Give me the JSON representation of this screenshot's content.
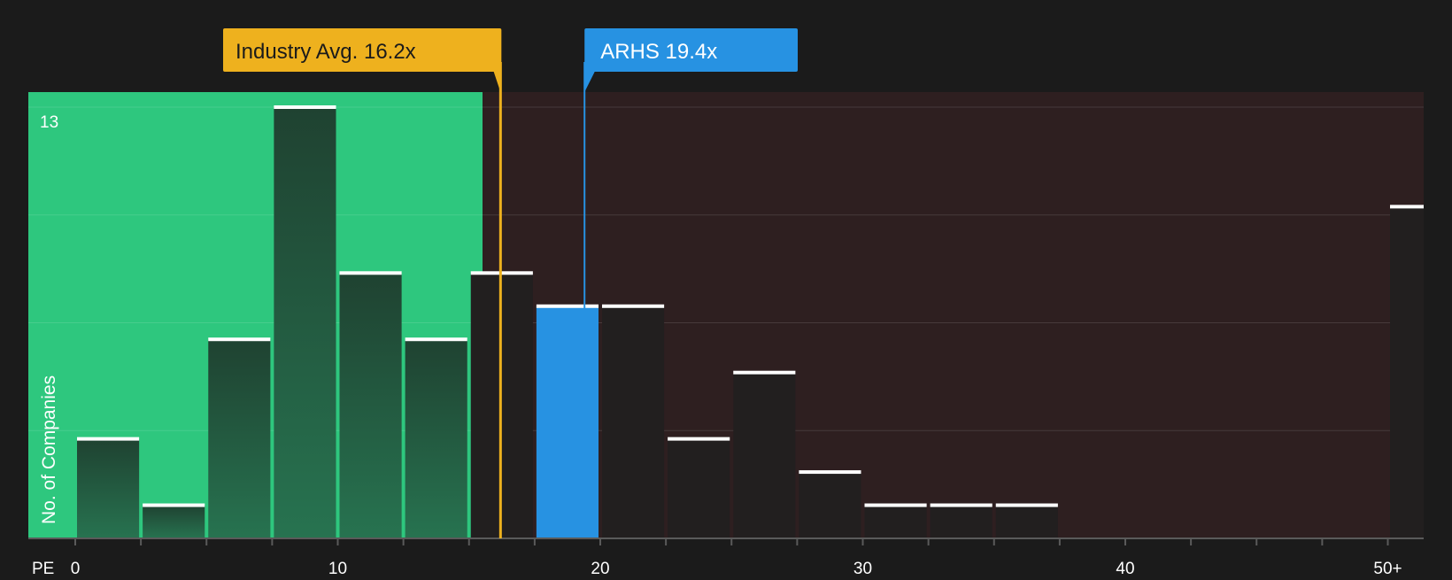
{
  "chart_data": {
    "type": "bar",
    "title": "",
    "xlabel": "PE",
    "ylabel": "No. of Companies",
    "ymax_label": "13",
    "ylim": [
      0,
      13
    ],
    "x_ticks": [
      "0",
      "10",
      "20",
      "30",
      "40",
      "50+"
    ],
    "bins": [
      {
        "range": "0-2.5",
        "value": 3
      },
      {
        "range": "2.5-5",
        "value": 1
      },
      {
        "range": "5-7.5",
        "value": 6
      },
      {
        "range": "7.5-10",
        "value": 13
      },
      {
        "range": "10-12.5",
        "value": 8
      },
      {
        "range": "12.5-15",
        "value": 6
      },
      {
        "range": "15-17.5",
        "value": 8
      },
      {
        "range": "17.5-20",
        "value": 7,
        "highlight": true
      },
      {
        "range": "20-22.5",
        "value": 7
      },
      {
        "range": "22.5-25",
        "value": 3
      },
      {
        "range": "25-27.5",
        "value": 5
      },
      {
        "range": "27.5-30",
        "value": 2
      },
      {
        "range": "30-32.5",
        "value": 1
      },
      {
        "range": "32.5-35",
        "value": 1
      },
      {
        "range": "35-37.5",
        "value": 1
      },
      {
        "range": "37.5-40",
        "value": 0
      },
      {
        "range": "40-42.5",
        "value": 0
      },
      {
        "range": "42.5-45",
        "value": 0
      },
      {
        "range": "45-47.5",
        "value": 0
      },
      {
        "range": "47.5-50",
        "value": 0
      },
      {
        "range": "50+",
        "value": 10
      }
    ],
    "industry_avg": {
      "label": "Industry Avg. 16.2x",
      "value": 16.2
    },
    "company": {
      "label": "ARHS 19.4x",
      "value": 19.4
    },
    "grid": true,
    "colors": {
      "background": "#1b1b1b",
      "undervalued_zone": "#2ec77e",
      "overvalued_zone": "#2e1f20",
      "bar_in_green": "#215a3e",
      "bar_in_red": "#221f1f",
      "highlight_bar": "#2792e2",
      "industry_marker": "#eeb11e",
      "company_marker": "#2792e2",
      "bar_cap": "#ffffff",
      "text": "#ffffff"
    }
  }
}
